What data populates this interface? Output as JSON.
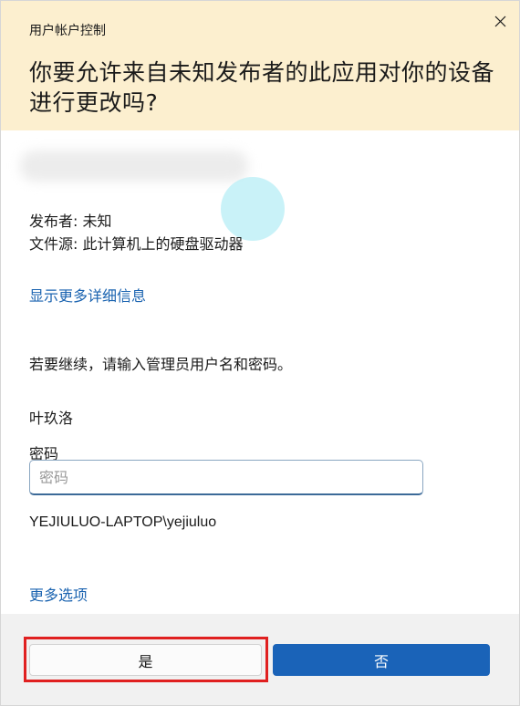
{
  "window": {
    "title": "用户帐户控制",
    "question": "你要允许来自未知发布者的此应用对你的设备进行更改吗?",
    "header_color": "#fcefcf"
  },
  "close_button": {
    "icon": "close-icon"
  },
  "app_info": {
    "publisher": "发布者: 未知",
    "file_source": "文件源: 此计算机上的硬盘驱动器",
    "details_link": "显示更多详细信息"
  },
  "credentials": {
    "instruction": "若要继续，请输入管理员用户名和密码。",
    "username": "叶玖洛",
    "password_label": "密码",
    "password_placeholder": "密码",
    "password_value": "",
    "domain_user": "YEJIULUO-LAPTOP\\yejiuluo",
    "more_options_link": "更多选项"
  },
  "buttons": {
    "yes_label": "是",
    "no_label": "否",
    "primary_color": "#1a63b8",
    "highlight_color": "#e02020"
  }
}
